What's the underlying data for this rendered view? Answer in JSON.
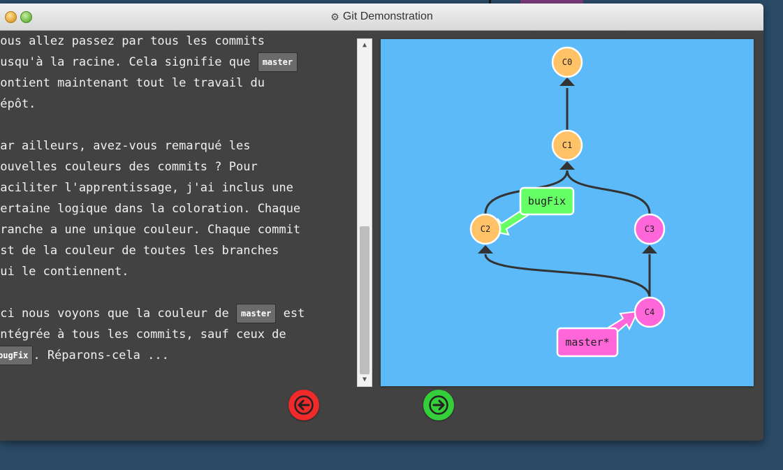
{
  "window": {
    "title": "Git Demonstration"
  },
  "text": {
    "p1_line1": "vous allez passez par tous les commits",
    "p1_line2a": "jusqu'à la racine. Cela signifie que ",
    "p1_code": "master",
    "p1_line3": "contient maintenant tout le travail du",
    "p1_line4": "dépôt.",
    "p2": "Par ailleurs, avez-vous remarqué les\nnouvelles couleurs des commits ? Pour\nfaciliter l'apprentissage, j'ai inclus une\ncertaine logique dans la coloration. Chaque\nbranche a une unique couleur. Chaque commit\nest de la couleur de toutes les branches\nqui le contiennent.",
    "p3_line1a": "Ici nous voyons que la couleur de ",
    "p3_code1": "master",
    "p3_line1b": " est",
    "p3_line2": "intégrée à tous les commits, sauf ceux de",
    "p3_code2": "bugFix",
    "p3_line3b": ". Réparons-cela ..."
  },
  "graph": {
    "commits": {
      "c0": "C0",
      "c1": "C1",
      "c2": "C2",
      "c3": "C3",
      "c4": "C4"
    },
    "branches": {
      "bugfix": "bugFix",
      "master": "master*"
    },
    "colors": {
      "background": "#5cbaf9",
      "commit_orange": "#ffc266",
      "commit_pink": "#ff66d9",
      "branch_green": "#66ff66",
      "branch_pink": "#ff66d9",
      "edge": "#333333"
    }
  },
  "nav": {
    "back_icon": "arrow-left-icon",
    "forward_icon": "arrow-right-icon"
  },
  "icons": {
    "title_icon": "gear-icon"
  }
}
